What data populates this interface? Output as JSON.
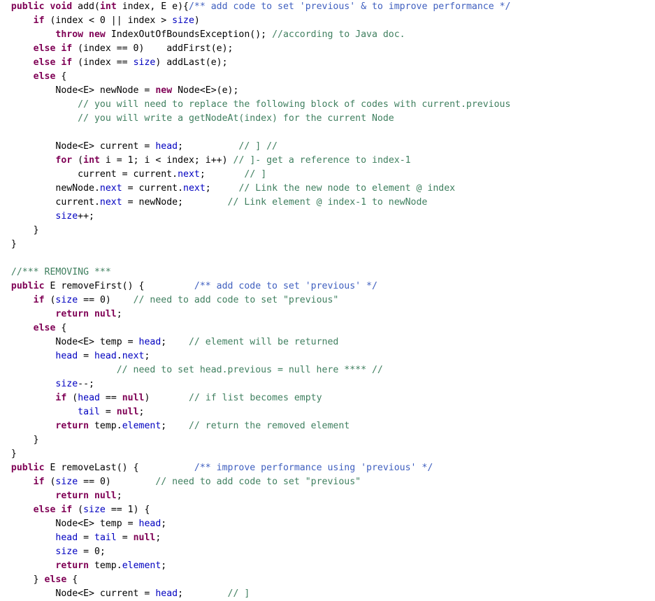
{
  "editor": {
    "language": "Java",
    "background": "#ffffff",
    "colors": {
      "keyword": "#7f0055",
      "field": "#0000c0",
      "plain": "#000000",
      "line_comment": "#3f7f5f",
      "javadoc_comment": "#3f5fbf"
    },
    "font_size_px": 13.2,
    "line_height_px": 20
  },
  "code": {
    "lines": [
      [
        {
          "t": "  ",
          "c": "def"
        },
        {
          "t": "public void ",
          "c": "kw"
        },
        {
          "t": "add(",
          "c": "def"
        },
        {
          "t": "int",
          "c": "kw"
        },
        {
          "t": " index, E e){",
          "c": "def"
        },
        {
          "t": "/** add code to set 'previous' & to improve performance */",
          "c": "jdoc"
        }
      ],
      [
        {
          "t": "      ",
          "c": "def"
        },
        {
          "t": "if",
          "c": "kw"
        },
        {
          "t": " (index < 0 || index > ",
          "c": "def"
        },
        {
          "t": "size",
          "c": "fld"
        },
        {
          "t": ")",
          "c": "def"
        }
      ],
      [
        {
          "t": "          ",
          "c": "def"
        },
        {
          "t": "throw new ",
          "c": "kw"
        },
        {
          "t": "IndexOutOfBoundsException(); ",
          "c": "def"
        },
        {
          "t": "//according to Java doc.",
          "c": "cmt"
        }
      ],
      [
        {
          "t": "      ",
          "c": "def"
        },
        {
          "t": "else if",
          "c": "kw"
        },
        {
          "t": " (index == 0)    addFirst(e);",
          "c": "def"
        }
      ],
      [
        {
          "t": "      ",
          "c": "def"
        },
        {
          "t": "else if",
          "c": "kw"
        },
        {
          "t": " (index == ",
          "c": "def"
        },
        {
          "t": "size",
          "c": "fld"
        },
        {
          "t": ") addLast(e);",
          "c": "def"
        }
      ],
      [
        {
          "t": "      ",
          "c": "def"
        },
        {
          "t": "else",
          "c": "kw"
        },
        {
          "t": " {",
          "c": "def"
        }
      ],
      [
        {
          "t": "          Node<E> newNode = ",
          "c": "def"
        },
        {
          "t": "new",
          "c": "kw"
        },
        {
          "t": " Node<E>(e);",
          "c": "def"
        }
      ],
      [
        {
          "t": "              ",
          "c": "def"
        },
        {
          "t": "// you will need to replace the following block of codes with current.previous",
          "c": "cmt"
        }
      ],
      [
        {
          "t": "              ",
          "c": "def"
        },
        {
          "t": "// you will write a getNodeAt(index) for the current Node",
          "c": "cmt"
        }
      ],
      [],
      [
        {
          "t": "          Node<E> current = ",
          "c": "def"
        },
        {
          "t": "head",
          "c": "fld"
        },
        {
          "t": ";          ",
          "c": "def"
        },
        {
          "t": "// ] //",
          "c": "cmt"
        }
      ],
      [
        {
          "t": "          ",
          "c": "def"
        },
        {
          "t": "for",
          "c": "kw"
        },
        {
          "t": " (",
          "c": "def"
        },
        {
          "t": "int",
          "c": "kw"
        },
        {
          "t": " i = 1; i < index; i++) ",
          "c": "def"
        },
        {
          "t": "// ]- get a reference to index-1",
          "c": "cmt"
        }
      ],
      [
        {
          "t": "              current = current.",
          "c": "def"
        },
        {
          "t": "next",
          "c": "fld"
        },
        {
          "t": ";       ",
          "c": "def"
        },
        {
          "t": "// ]",
          "c": "cmt"
        }
      ],
      [
        {
          "t": "          newNode.",
          "c": "def"
        },
        {
          "t": "next",
          "c": "fld"
        },
        {
          "t": " = current.",
          "c": "def"
        },
        {
          "t": "next",
          "c": "fld"
        },
        {
          "t": ";     ",
          "c": "def"
        },
        {
          "t": "// Link the new node to element @ index",
          "c": "cmt"
        }
      ],
      [
        {
          "t": "          current.",
          "c": "def"
        },
        {
          "t": "next",
          "c": "fld"
        },
        {
          "t": " = newNode;        ",
          "c": "def"
        },
        {
          "t": "// Link element @ index-1 to newNode",
          "c": "cmt"
        }
      ],
      [
        {
          "t": "          ",
          "c": "def"
        },
        {
          "t": "size",
          "c": "fld"
        },
        {
          "t": "++;",
          "c": "def"
        }
      ],
      [
        {
          "t": "      }",
          "c": "def"
        }
      ],
      [
        {
          "t": "  }",
          "c": "def"
        }
      ],
      [],
      [
        {
          "t": "  ",
          "c": "def"
        },
        {
          "t": "//*** REMOVING ***",
          "c": "cmt"
        }
      ],
      [
        {
          "t": "  ",
          "c": "def"
        },
        {
          "t": "public",
          "c": "kw"
        },
        {
          "t": " E removeFirst() {         ",
          "c": "def"
        },
        {
          "t": "/** add code to set 'previous' */",
          "c": "jdoc"
        }
      ],
      [
        {
          "t": "      ",
          "c": "def"
        },
        {
          "t": "if",
          "c": "kw"
        },
        {
          "t": " (",
          "c": "def"
        },
        {
          "t": "size",
          "c": "fld"
        },
        {
          "t": " == 0)    ",
          "c": "def"
        },
        {
          "t": "// need to add code to set \"previous\"",
          "c": "cmt"
        }
      ],
      [
        {
          "t": "          ",
          "c": "def"
        },
        {
          "t": "return null",
          "c": "kw"
        },
        {
          "t": ";",
          "c": "def"
        }
      ],
      [
        {
          "t": "      ",
          "c": "def"
        },
        {
          "t": "else",
          "c": "kw"
        },
        {
          "t": " {",
          "c": "def"
        }
      ],
      [
        {
          "t": "          Node<E> temp = ",
          "c": "def"
        },
        {
          "t": "head",
          "c": "fld"
        },
        {
          "t": ";    ",
          "c": "def"
        },
        {
          "t": "// element will be returned",
          "c": "cmt"
        }
      ],
      [
        {
          "t": "          ",
          "c": "def"
        },
        {
          "t": "head",
          "c": "fld"
        },
        {
          "t": " = ",
          "c": "def"
        },
        {
          "t": "head",
          "c": "fld"
        },
        {
          "t": ".",
          "c": "def"
        },
        {
          "t": "next",
          "c": "fld"
        },
        {
          "t": ";",
          "c": "def"
        }
      ],
      [
        {
          "t": "                     ",
          "c": "def"
        },
        {
          "t": "// need to set head.previous = null here **** //",
          "c": "cmt"
        }
      ],
      [
        {
          "t": "          ",
          "c": "def"
        },
        {
          "t": "size",
          "c": "fld"
        },
        {
          "t": "--;",
          "c": "def"
        }
      ],
      [
        {
          "t": "          ",
          "c": "def"
        },
        {
          "t": "if",
          "c": "kw"
        },
        {
          "t": " (",
          "c": "def"
        },
        {
          "t": "head",
          "c": "fld"
        },
        {
          "t": " == ",
          "c": "def"
        },
        {
          "t": "null",
          "c": "kw"
        },
        {
          "t": ")       ",
          "c": "def"
        },
        {
          "t": "// if list becomes empty",
          "c": "cmt"
        }
      ],
      [
        {
          "t": "              ",
          "c": "def"
        },
        {
          "t": "tail",
          "c": "fld"
        },
        {
          "t": " = ",
          "c": "def"
        },
        {
          "t": "null",
          "c": "kw"
        },
        {
          "t": ";",
          "c": "def"
        }
      ],
      [
        {
          "t": "          ",
          "c": "def"
        },
        {
          "t": "return",
          "c": "kw"
        },
        {
          "t": " temp.",
          "c": "def"
        },
        {
          "t": "element",
          "c": "fld"
        },
        {
          "t": ";    ",
          "c": "def"
        },
        {
          "t": "// return the removed element",
          "c": "cmt"
        }
      ],
      [
        {
          "t": "      }",
          "c": "def"
        }
      ],
      [
        {
          "t": "  }",
          "c": "def"
        }
      ],
      [
        {
          "t": "  ",
          "c": "def"
        },
        {
          "t": "public",
          "c": "kw"
        },
        {
          "t": " E removeLast() {          ",
          "c": "def"
        },
        {
          "t": "/** improve performance using 'previous' */",
          "c": "jdoc"
        }
      ],
      [
        {
          "t": "      ",
          "c": "def"
        },
        {
          "t": "if",
          "c": "kw"
        },
        {
          "t": " (",
          "c": "def"
        },
        {
          "t": "size",
          "c": "fld"
        },
        {
          "t": " == 0)        ",
          "c": "def"
        },
        {
          "t": "// need to add code to set \"previous\"",
          "c": "cmt"
        }
      ],
      [
        {
          "t": "          ",
          "c": "def"
        },
        {
          "t": "return null",
          "c": "kw"
        },
        {
          "t": ";",
          "c": "def"
        }
      ],
      [
        {
          "t": "      ",
          "c": "def"
        },
        {
          "t": "else if",
          "c": "kw"
        },
        {
          "t": " (",
          "c": "def"
        },
        {
          "t": "size",
          "c": "fld"
        },
        {
          "t": " == 1) {",
          "c": "def"
        }
      ],
      [
        {
          "t": "          Node<E> temp = ",
          "c": "def"
        },
        {
          "t": "head",
          "c": "fld"
        },
        {
          "t": ";",
          "c": "def"
        }
      ],
      [
        {
          "t": "          ",
          "c": "def"
        },
        {
          "t": "head",
          "c": "fld"
        },
        {
          "t": " = ",
          "c": "def"
        },
        {
          "t": "tail",
          "c": "fld"
        },
        {
          "t": " = ",
          "c": "def"
        },
        {
          "t": "null",
          "c": "kw"
        },
        {
          "t": ";",
          "c": "def"
        }
      ],
      [
        {
          "t": "          ",
          "c": "def"
        },
        {
          "t": "size",
          "c": "fld"
        },
        {
          "t": " = 0;",
          "c": "def"
        }
      ],
      [
        {
          "t": "          ",
          "c": "def"
        },
        {
          "t": "return",
          "c": "kw"
        },
        {
          "t": " temp.",
          "c": "def"
        },
        {
          "t": "element",
          "c": "fld"
        },
        {
          "t": ";",
          "c": "def"
        }
      ],
      [
        {
          "t": "      } ",
          "c": "def"
        },
        {
          "t": "else",
          "c": "kw"
        },
        {
          "t": " {",
          "c": "def"
        }
      ],
      [
        {
          "t": "          Node<E> current = ",
          "c": "def"
        },
        {
          "t": "head",
          "c": "fld"
        },
        {
          "t": ";        ",
          "c": "def"
        },
        {
          "t": "// ]",
          "c": "cmt"
        }
      ]
    ]
  }
}
